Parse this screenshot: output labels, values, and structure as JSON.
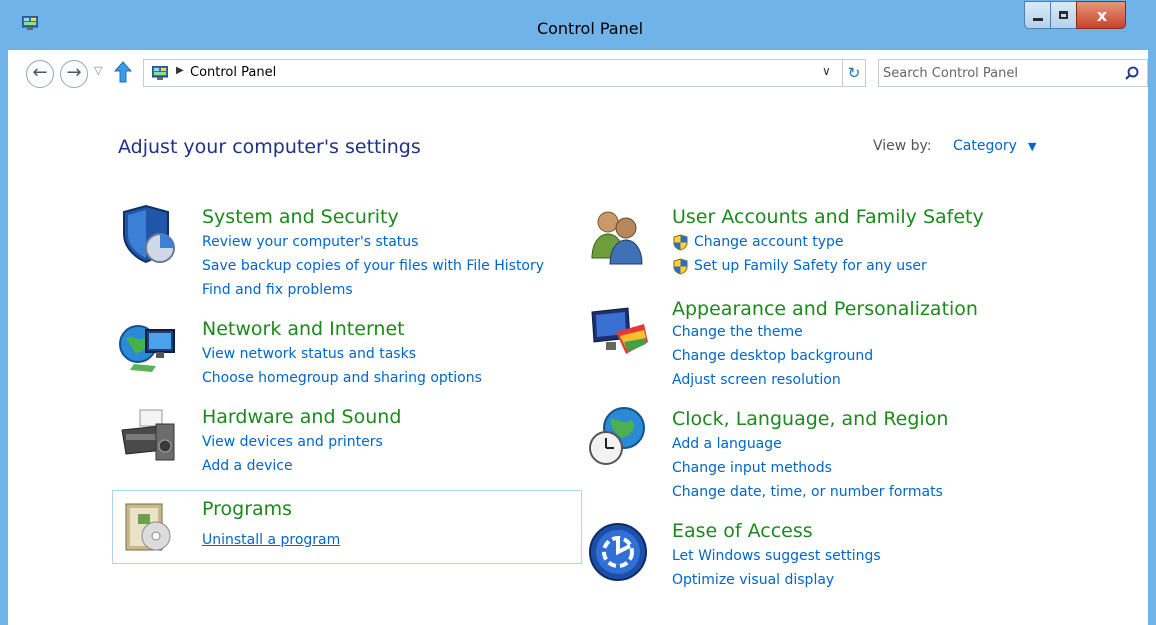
{
  "window": {
    "title": "Control Panel",
    "icon": "control-panel-icon",
    "controls": {
      "minimize": "minimize",
      "maximize": "maximize",
      "close": "x"
    }
  },
  "navigation": {
    "back_icon": "back-arrow-icon",
    "forward_icon": "forward-arrow-icon",
    "recent_icon": "chevron-down-icon",
    "up_icon": "up-arrow-icon",
    "address_path": "Control Panel",
    "address_sep_icon": "triangle-right-icon",
    "dropdown_icon": "chevron-down-icon",
    "refresh_icon": "refresh-icon",
    "search_placeholder": "Search Control Panel",
    "search_icon": "search-icon"
  },
  "main": {
    "heading": "Adjust your computer's settings",
    "view_by_label": "View by:",
    "view_by_value": "Category",
    "view_by_caret": "▼",
    "categories": [
      {
        "title": "System and Security",
        "icon": "shield-icon",
        "links": [
          "Review your computer's status",
          "Save backup copies of your files with File History",
          "Find and fix problems"
        ]
      },
      {
        "title": "Network and Internet",
        "icon": "network-icon",
        "links": [
          "View network status and tasks",
          "Choose homegroup and sharing options"
        ]
      },
      {
        "title": "Hardware and Sound",
        "icon": "printer-icon",
        "links": [
          "View devices and printers",
          "Add a device"
        ]
      },
      {
        "title": "Programs",
        "icon": "programs-icon",
        "links": [
          "Uninstall a program"
        ]
      },
      {
        "title": "User Accounts and Family Safety",
        "icon": "users-icon",
        "links": [
          "Change account type",
          "Set up Family Safety for any user"
        ]
      },
      {
        "title": "Appearance and Personalization",
        "icon": "monitor-palette-icon",
        "links": [
          "Change the theme",
          "Change desktop background",
          "Adjust screen resolution"
        ]
      },
      {
        "title": "Clock, Language, and Region",
        "icon": "globe-clock-icon",
        "links": [
          "Add a language",
          "Change input methods",
          "Change date, time, or number formats"
        ]
      },
      {
        "title": "Ease of Access",
        "icon": "ease-of-access-icon",
        "links": [
          "Let Windows suggest settings",
          "Optimize visual display"
        ]
      }
    ]
  },
  "colors": {
    "titlebar": "#6fb3e8",
    "category_title": "#1b8a1b",
    "link": "#0066cc",
    "heading": "#1e3287"
  }
}
